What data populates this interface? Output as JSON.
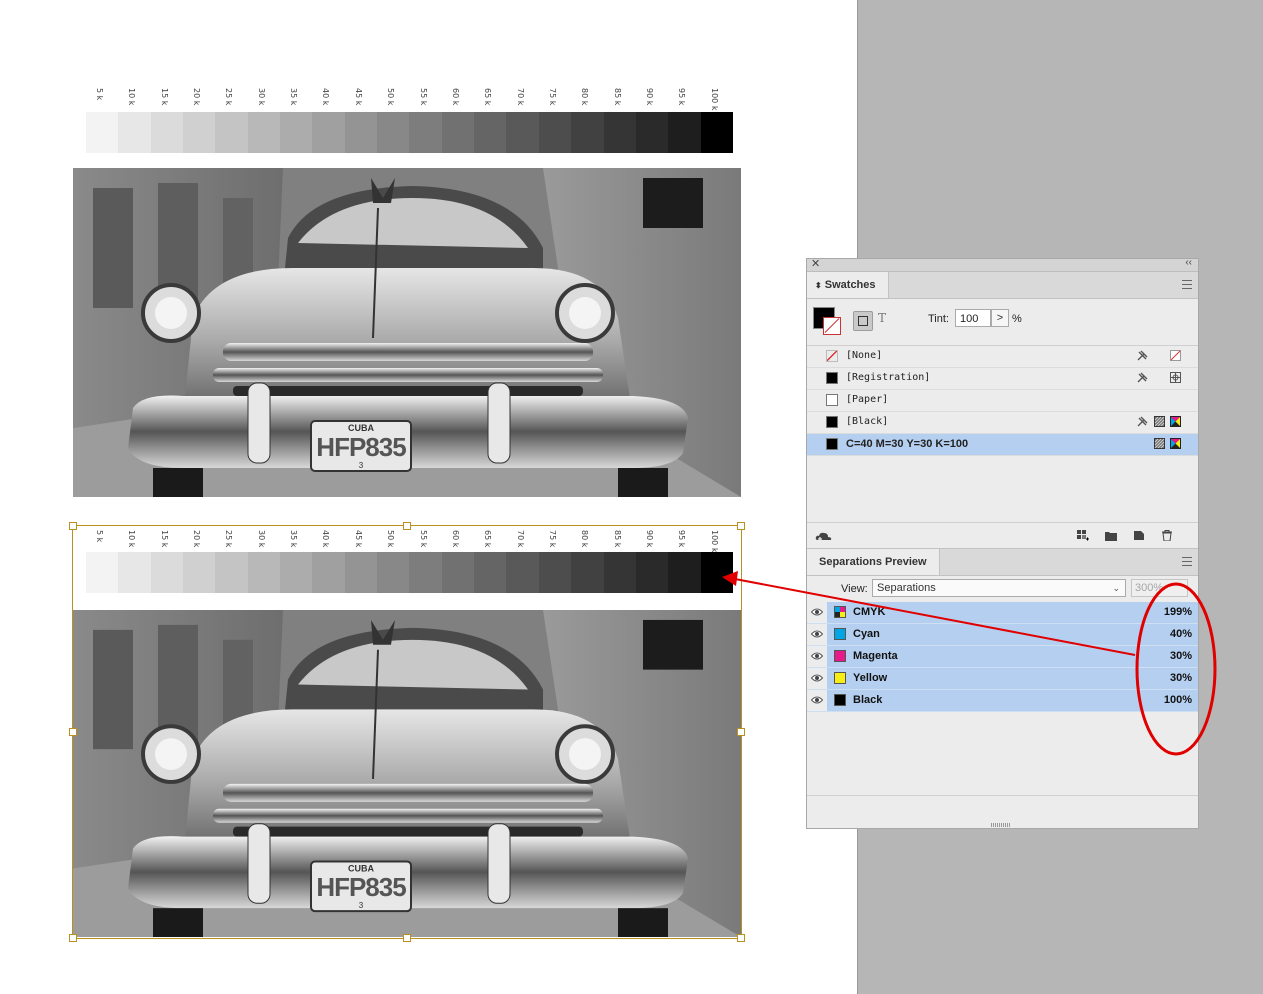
{
  "ramp": {
    "labels": [
      "5 k",
      "10 k",
      "15 k",
      "20 k",
      "25 k",
      "30 k",
      "35 k",
      "40 k",
      "45 k",
      "50 k",
      "55 k",
      "60 k",
      "65 k",
      "70 k",
      "75 k",
      "80 k",
      "85 k",
      "90 k",
      "95 k",
      "100 k"
    ],
    "values": [
      5,
      10,
      15,
      20,
      25,
      30,
      35,
      40,
      45,
      50,
      55,
      60,
      65,
      70,
      75,
      80,
      85,
      90,
      95,
      100
    ]
  },
  "photo": {
    "plate_country": "CUBA",
    "plate_number": "HFP835",
    "plate_suffix": "3"
  },
  "swatches": {
    "title": "Swatches",
    "tint_label": "Tint:",
    "tint_value": "100",
    "tint_step": ">",
    "tint_unit": "%",
    "text_button": "T",
    "items": [
      {
        "name": "[None]",
        "color": "none"
      },
      {
        "name": "[Registration]",
        "color": "#000000"
      },
      {
        "name": "[Paper]",
        "color": "#ffffff"
      },
      {
        "name": "[Black]",
        "color": "#000000"
      },
      {
        "name": "C=40 M=30 Y=30 K=100",
        "color": "#000000"
      }
    ]
  },
  "separations": {
    "title": "Separations Preview",
    "view_label": "View:",
    "view_value": "Separations",
    "zoom_value": "300%",
    "rows": [
      {
        "name": "CMYK",
        "pct": "199%",
        "color": "cmyk"
      },
      {
        "name": "Cyan",
        "pct": "40%",
        "color": "#00a6e4"
      },
      {
        "name": "Magenta",
        "pct": "30%",
        "color": "#e6198b"
      },
      {
        "name": "Yellow",
        "pct": "30%",
        "color": "#f8ee16"
      },
      {
        "name": "Black",
        "pct": "100%",
        "color": "#000000"
      }
    ]
  },
  "colors": {
    "selection_highlight": "#b5cff0",
    "annotation_red": "#e00000",
    "frame_gold": "#b8911e"
  }
}
